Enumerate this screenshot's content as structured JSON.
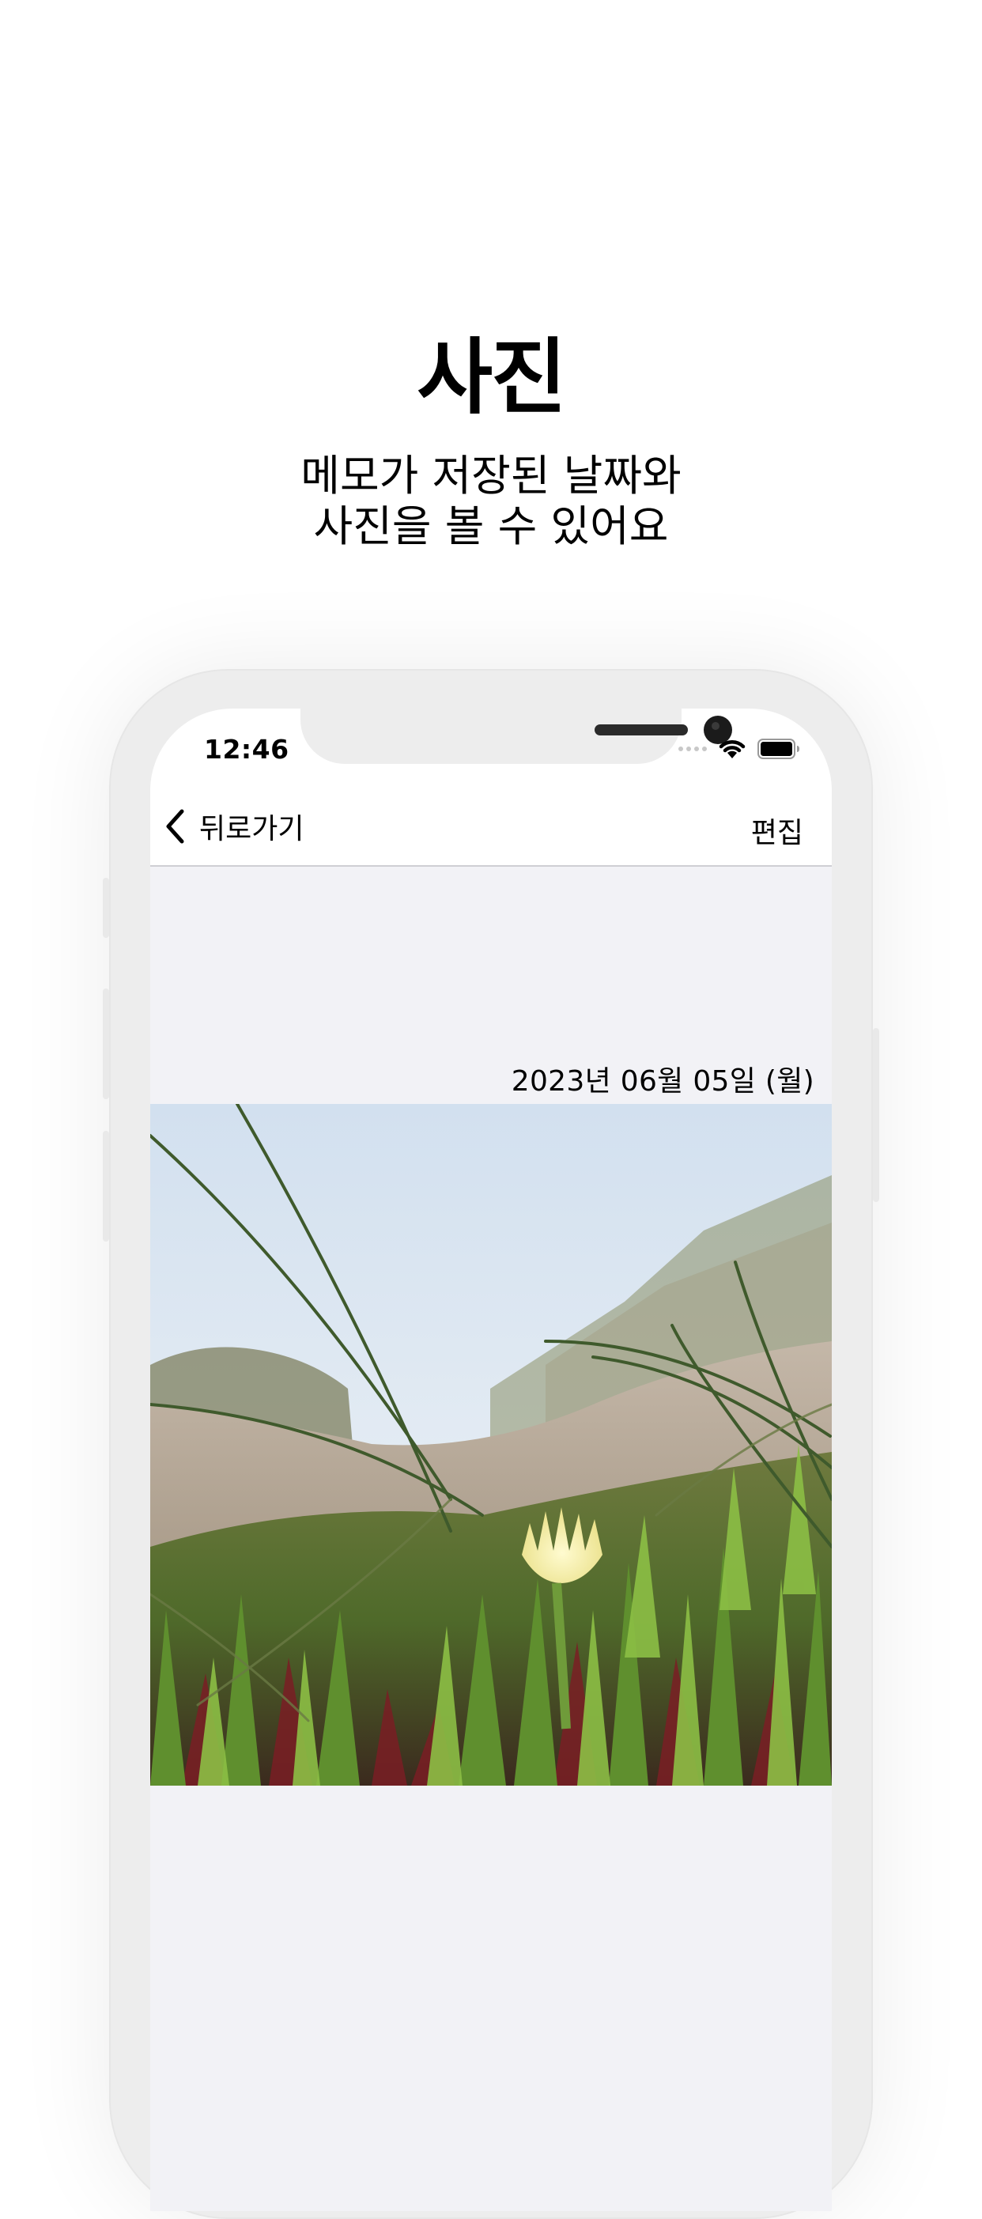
{
  "marketing": {
    "title": "사진",
    "subtitle_line1": "메모가 저장된 날짜와",
    "subtitle_line2": "사진을 볼 수 있어요"
  },
  "status_bar": {
    "time": "12:46"
  },
  "navbar": {
    "back_label": "뒤로가기",
    "edit_label": "편집"
  },
  "memo": {
    "date": "2023년 06월 05일 (월)"
  },
  "icons": {
    "back": "chevron-left-icon",
    "wifi": "wifi-icon",
    "battery": "battery-icon",
    "signal": "cellular-signal-icon"
  },
  "colors": {
    "content_background": "#f2f2f6",
    "frame": "#ededed",
    "text": "#000000"
  }
}
